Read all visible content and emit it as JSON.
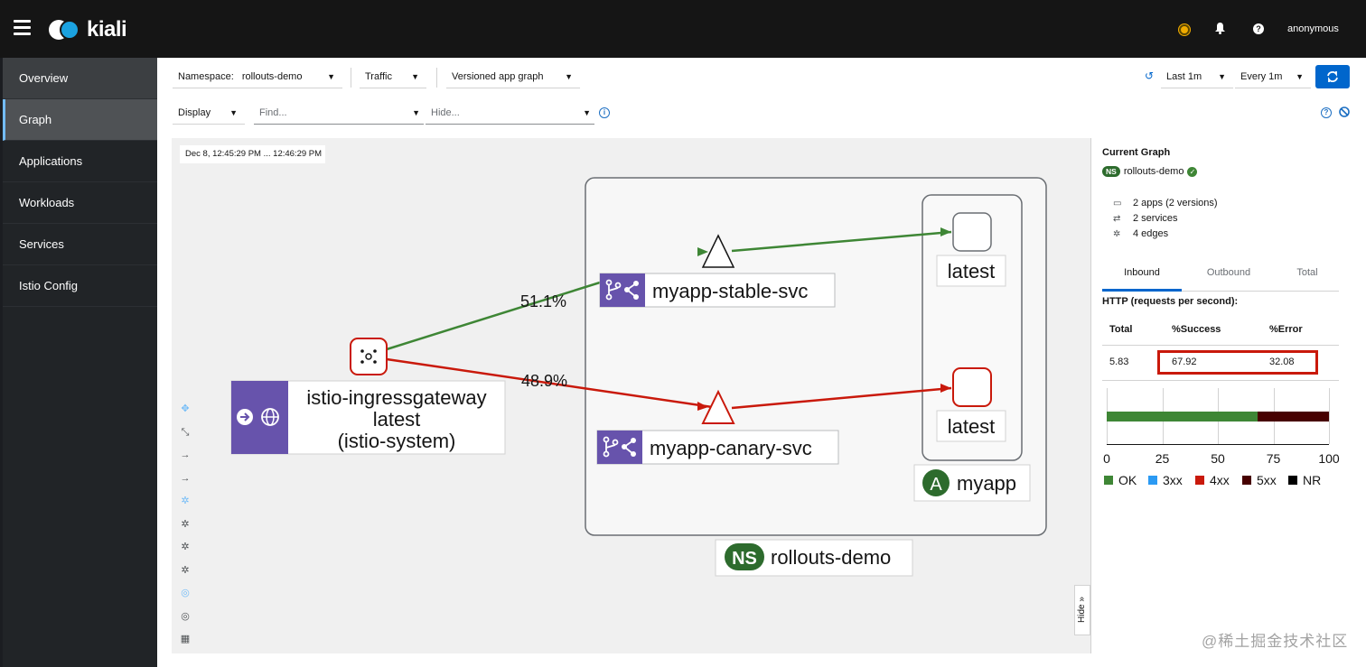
{
  "header": {
    "brand": "kiali",
    "user": "anonymous",
    "help_glyph": "?",
    "icons": [
      "menu-icon",
      "status-icon",
      "bell-icon",
      "help-icon"
    ]
  },
  "sidebar": {
    "items": [
      {
        "label": "Overview"
      },
      {
        "label": "Graph"
      },
      {
        "label": "Applications"
      },
      {
        "label": "Workloads"
      },
      {
        "label": "Services"
      },
      {
        "label": "Istio Config"
      }
    ]
  },
  "toolbar": {
    "namespace_label": "Namespace:",
    "namespace_value": "rollouts-demo",
    "traffic": "Traffic",
    "graph_type": "Versioned app graph",
    "display": "Display",
    "find_placeholder": "Find...",
    "hide_placeholder": "Hide...",
    "duration": "Last 1m",
    "refresh_interval": "Every 1m"
  },
  "graph": {
    "time_range": "Dec 8, 12:45:29 PM ... 12:46:29 PM",
    "hide_label": "Hide",
    "namespace_badge": "NS",
    "namespace": "rollouts-demo",
    "app_badge": "A",
    "app": "myapp",
    "ingress": {
      "name": "istio-ingressgateway",
      "version": "latest",
      "namespace": "(istio-system)"
    },
    "services": [
      {
        "name": "myapp-stable-svc"
      },
      {
        "name": "myapp-canary-svc"
      }
    ],
    "workloads": [
      {
        "version": "latest"
      },
      {
        "version": "latest"
      }
    ],
    "edges": [
      {
        "label": "51.1%",
        "color": "#3e8635"
      },
      {
        "label": "48.9%",
        "color": "#c9190b"
      }
    ]
  },
  "panel": {
    "title": "Current Graph",
    "ns_badge": "NS",
    "namespace": "rollouts-demo",
    "stats": [
      "2 apps (2 versions)",
      "2 services",
      "4 edges"
    ],
    "tabs": [
      "Inbound",
      "Outbound",
      "Total"
    ],
    "active_tab": "Inbound",
    "http_title": "HTTP (requests per second):",
    "table": {
      "headers": [
        "Total",
        "%Success",
        "%Error"
      ],
      "row": [
        "5.83",
        "67.92",
        "32.08"
      ]
    }
  },
  "chart_data": {
    "type": "bar",
    "orientation": "horizontal-stacked",
    "xlim": [
      0,
      100
    ],
    "ticks": [
      "0",
      "25",
      "50",
      "75",
      "100"
    ],
    "series": [
      {
        "name": "OK",
        "value": 67.92,
        "color": "#3e8635"
      },
      {
        "name": "3xx",
        "value": 0,
        "color": "#2b9af3"
      },
      {
        "name": "4xx",
        "value": 0,
        "color": "#c9190b"
      },
      {
        "name": "5xx",
        "value": 32.08,
        "color": "#470000"
      },
      {
        "name": "NR",
        "value": 0,
        "color": "#000000"
      }
    ]
  },
  "watermark": "@稀土掘金技术社区"
}
